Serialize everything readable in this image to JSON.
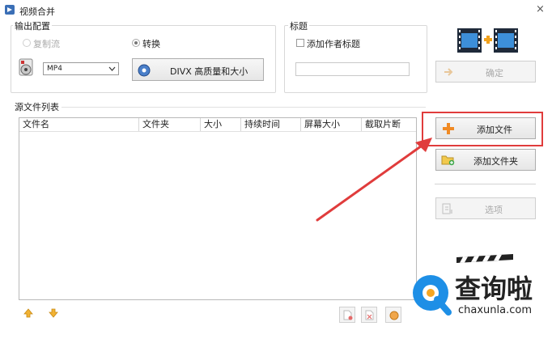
{
  "window": {
    "title": "视频合并",
    "close_glyph": "×"
  },
  "output_config": {
    "group_label": "输出配置",
    "copy_stream_label": "复制流",
    "convert_label": "转换",
    "format_value": "MP4",
    "format_options_selected": "MP4",
    "profile_label": "DIVX 高质量和大小"
  },
  "title_group": {
    "group_label": "标题",
    "add_author_title_label": "添加作者标题",
    "title_value": ""
  },
  "confirm_button": {
    "label": "确定"
  },
  "source_list": {
    "group_label": "源文件列表",
    "columns": [
      "文件名",
      "文件夹",
      "大小",
      "持续时间",
      "屏幕大小",
      "截取片断"
    ],
    "rows": []
  },
  "side_buttons": {
    "add_file": "添加文件",
    "add_folder": "添加文件夹",
    "options": "选项"
  },
  "watermark": {
    "text": "查询啦",
    "url": "chaxunla.com"
  },
  "colors": {
    "annotation_red": "#e03c3c",
    "add_plus_orange": "#f08a24",
    "watermark_blue": "#1e8fe6"
  }
}
